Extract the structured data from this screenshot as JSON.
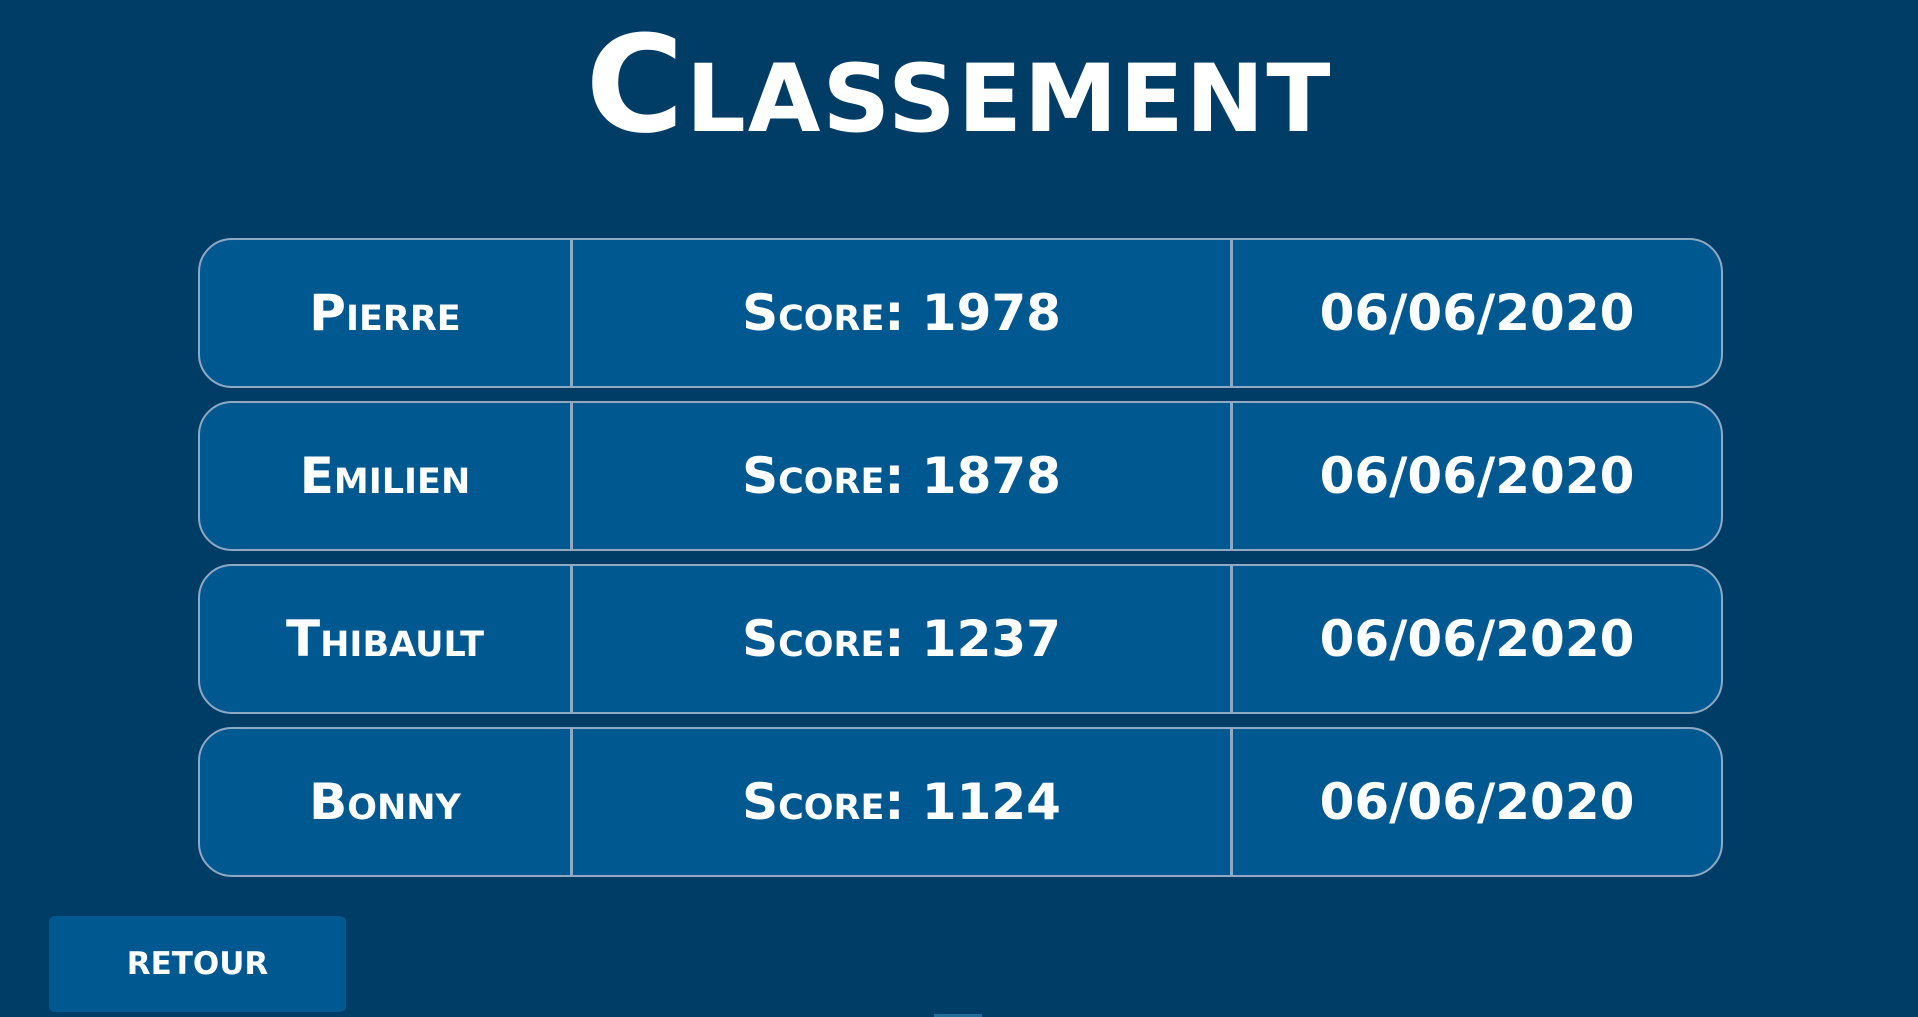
{
  "header": {
    "title": "Classement"
  },
  "leaderboard": {
    "rows": [
      {
        "name": "Pierre",
        "score": "Score: 1978",
        "date": "06/06/2020"
      },
      {
        "name": "Emilien",
        "score": "Score: 1878",
        "date": "06/06/2020"
      },
      {
        "name": "Thibault",
        "score": "Score: 1237",
        "date": "06/06/2020"
      },
      {
        "name": "Bonny",
        "score": "Score: 1124",
        "date": "06/06/2020"
      }
    ]
  },
  "footer": {
    "back_label": "RETOUR"
  },
  "colors": {
    "background": "#003d66",
    "panel": "#005891",
    "border": "#8fa8c4",
    "text": "#ffffff"
  }
}
